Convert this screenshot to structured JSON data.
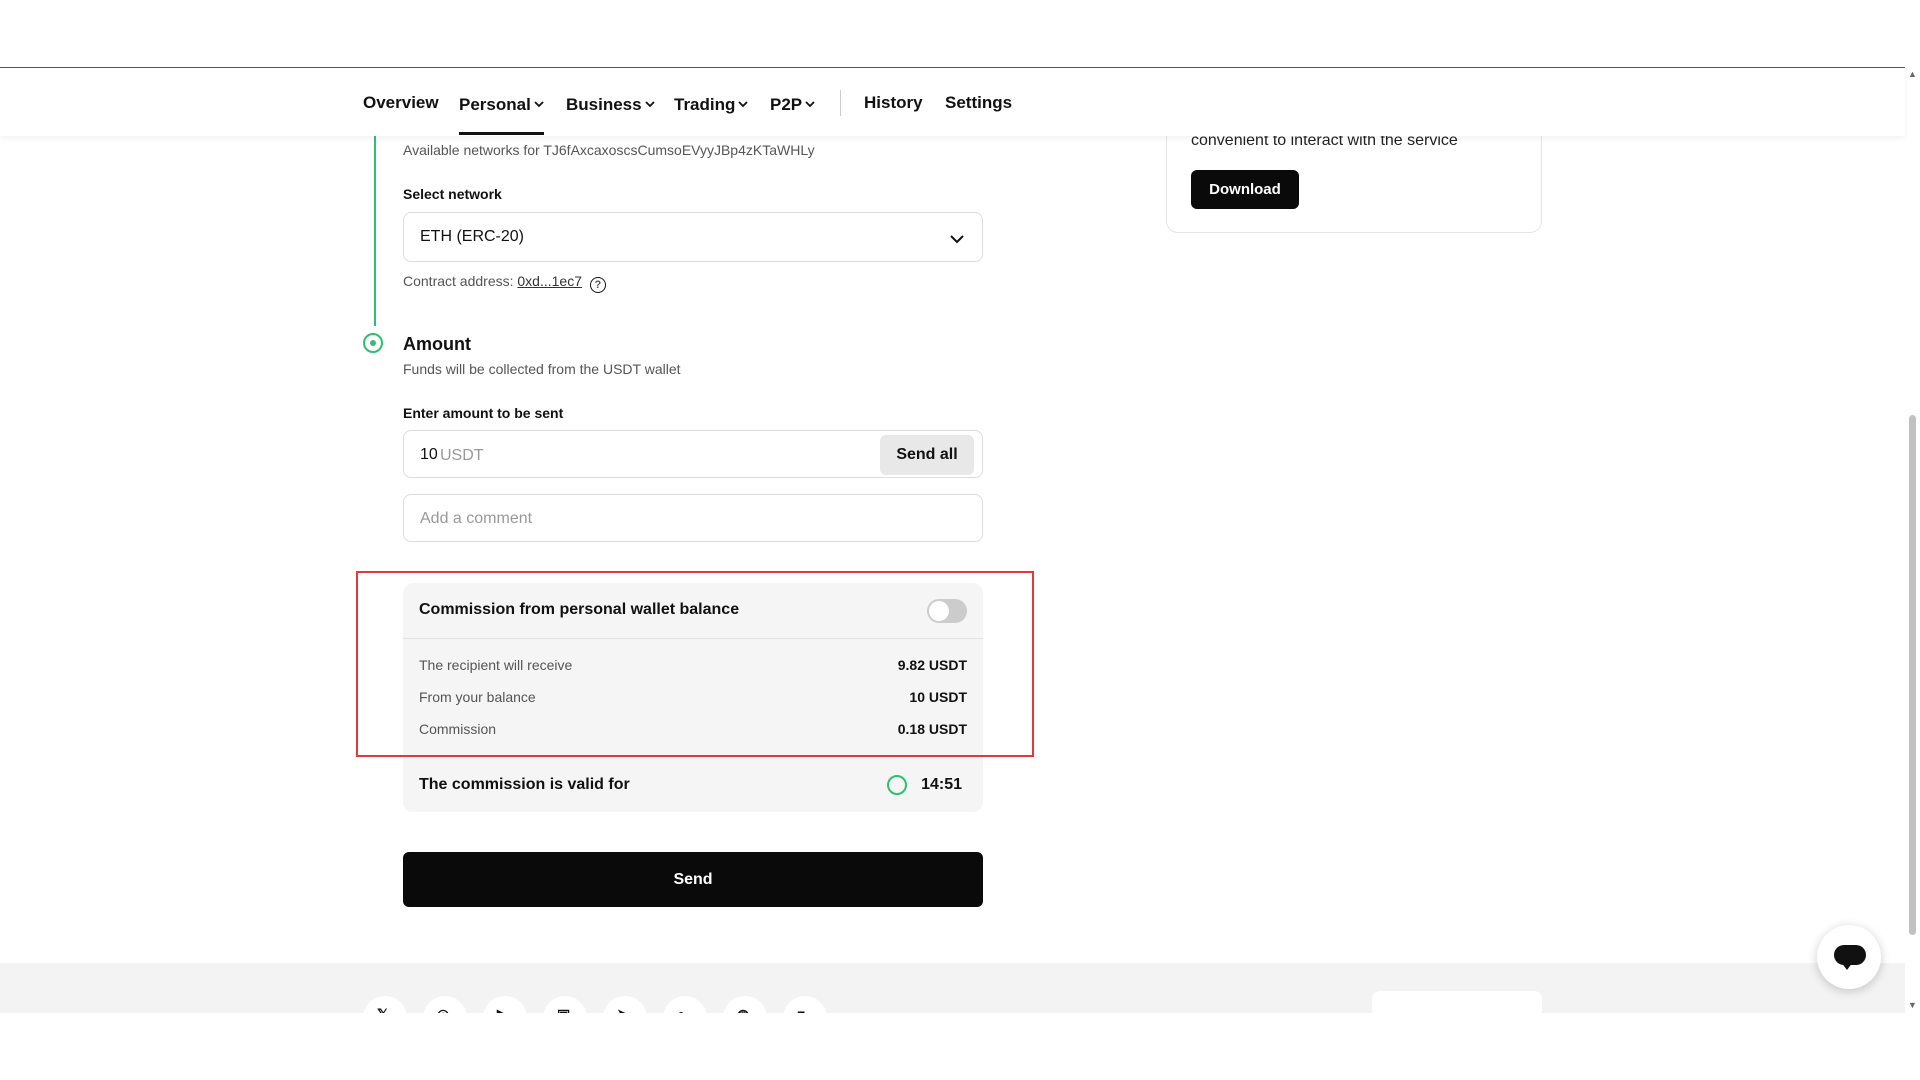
{
  "nav": {
    "items": [
      {
        "label": "Overview",
        "dropdown": false
      },
      {
        "label": "Personal",
        "dropdown": true,
        "active": true
      },
      {
        "label": "Business",
        "dropdown": true
      },
      {
        "label": "Trading",
        "dropdown": true
      },
      {
        "label": "P2P",
        "dropdown": true
      },
      {
        "label": "History",
        "dropdown": false
      },
      {
        "label": "Settings",
        "dropdown": false
      }
    ]
  },
  "network": {
    "available_text": "Available networks for TJ6fAxcaxoscsCumsoEVyyJBp4zKTaWHLy",
    "select_label": "Select network",
    "selected": "ETH (ERC-20)",
    "contract_label": "Contract address:",
    "contract_value": "0xd...1ec7"
  },
  "amount": {
    "title": "Amount",
    "subtitle": "Funds will be collected from the USDT wallet",
    "input_label": "Enter amount to be sent",
    "value": "10",
    "currency": "USDT",
    "send_all": "Send all",
    "comment_placeholder": "Add a comment"
  },
  "commission": {
    "title": "Commission from personal wallet balance",
    "toggle_on": false,
    "rows": [
      {
        "label": "The recipient will receive",
        "value": "9.82 USDT"
      },
      {
        "label": "From your balance",
        "value": "10 USDT"
      },
      {
        "label": "Commission",
        "value": "0.18 USDT"
      }
    ],
    "valid_label": "The commission is valid for",
    "timer": "14:51"
  },
  "send_button": "Send",
  "side_card": {
    "text": "convenient to interact with the service",
    "download": "Download"
  },
  "colors": {
    "accent_green": "#2fbf71",
    "highlight_red": "#e53935",
    "button_dark": "#0a0a0a"
  }
}
